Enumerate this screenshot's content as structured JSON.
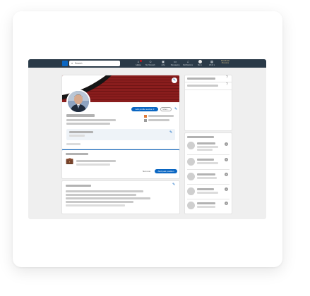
{
  "topnav": {
    "search_placeholder": "Search",
    "items": [
      {
        "label": "Home",
        "icon": "home-icon"
      },
      {
        "label": "My Network",
        "icon": "network-icon"
      },
      {
        "label": "Jobs",
        "icon": "jobs-icon"
      },
      {
        "label": "Messaging",
        "icon": "messaging-icon"
      },
      {
        "label": "Notifications",
        "icon": "bell-icon"
      },
      {
        "label": "Me ▾",
        "icon": "me-avatar"
      },
      {
        "label": "Work ▾",
        "icon": "grid-icon"
      }
    ],
    "premium": [
      "Reactivate",
      "Premium"
    ]
  },
  "profile": {
    "add_section_label": "Add profile section ▾",
    "more_label": "More..."
  },
  "position_prompt": {
    "not_now_label": "Not now",
    "add_position_label": "Add past position"
  },
  "colors": {
    "nav_bg": "#2a3a48",
    "accent": "#0a66c2",
    "banner": "#861c1c"
  }
}
